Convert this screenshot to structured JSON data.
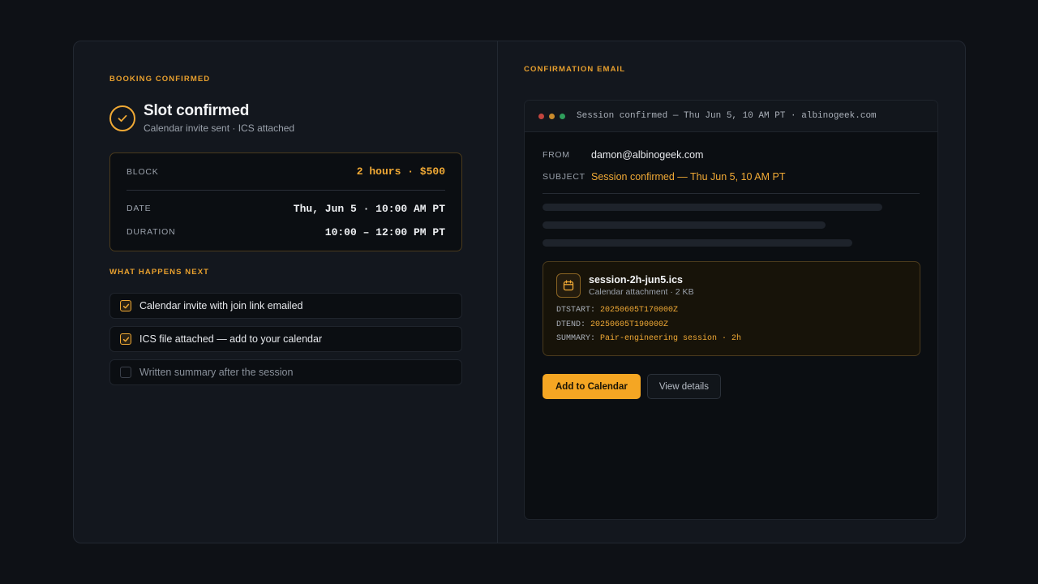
{
  "booking": {
    "eyebrow": "BOOKING CONFIRMED",
    "title": "Slot confirmed",
    "subtitle": "Calendar invite sent · ICS attached",
    "details": [
      {
        "label": "BLOCK",
        "value": "2 hours · $500"
      },
      {
        "label": "DATE",
        "value": "Thu, Jun 5 · 10:00 AM PT"
      },
      {
        "label": "DURATION",
        "value": "10:00 – 12:00 PM PT"
      }
    ]
  },
  "next": {
    "title": "WHAT HAPPENS NEXT",
    "steps": [
      {
        "label": "Calendar invite with join link emailed",
        "checked": true
      },
      {
        "label": "ICS file attached — add to your calendar",
        "checked": true
      },
      {
        "label": "Written summary after the session",
        "checked": false
      }
    ]
  },
  "email": {
    "eyebrow": "CONFIRMATION EMAIL",
    "window_title": "Session confirmed — Thu Jun 5, 10 AM PT · albinogeek.com",
    "from_label": "FROM",
    "from_value": "damon@albinogeek.com",
    "subject_label": "SUBJECT",
    "subject_value": "Session confirmed — Thu Jun 5, 10 AM PT",
    "attachment": {
      "icon": "calendar-icon",
      "filename": "session-2h-jun5.ics",
      "meta": "Calendar attachment · 2 KB",
      "lines": [
        {
          "key": "DTSTART:",
          "value": "20250605T170000Z"
        },
        {
          "key": "DTEND:",
          "value": "20250605T190000Z"
        },
        {
          "key": "SUMMARY:",
          "value": "Pair-engineering session · 2h"
        }
      ]
    },
    "primary_action": "Add to Calendar",
    "secondary_action": "View details"
  },
  "colors": {
    "accent": "#f5a623",
    "background": "#0e1116",
    "card": "#13171e",
    "dot_red": "#c2453e",
    "dot_yellow": "#c98b2c",
    "dot_green": "#2f9e5b"
  }
}
